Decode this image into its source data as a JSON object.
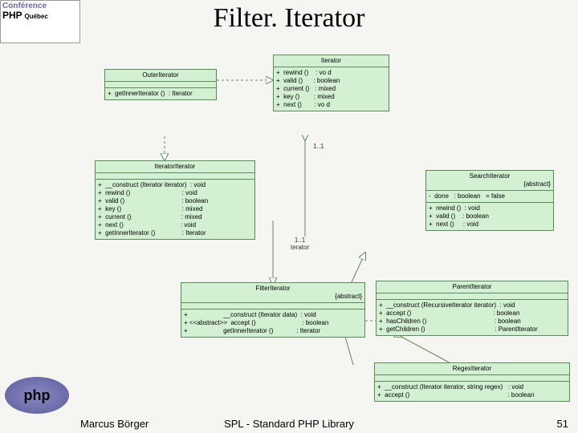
{
  "logo": {
    "line1": "Conférence",
    "line2": "PHP",
    "sub": "Québec"
  },
  "title": "Filter. Iterator",
  "roles": {
    "top": "1..1",
    "mid": "1..1\nterator"
  },
  "footer": {
    "author": "Marcus Börger",
    "center": "SPL - Standard PHP Library",
    "page": "51"
  },
  "php_logo": "php",
  "boxes": {
    "iterator": {
      "name": "Iterator",
      "ops": "+  rewind ()    : vo d\n+  valid ()      : boolean\n+  current ()   : mixed\n+  key ()        : mixed\n+  next ()       : vo d"
    },
    "outer": {
      "name": "OuterIterator",
      "ops": "+  getInnerIterator ()  : Iterator"
    },
    "iteratoriterator": {
      "name": "IteratorIterator",
      "ops": "+  __construct (Iterator iterator)  : void\n+  rewind ()                             : void\n+  valid ()                                : boolean\n+  key ()                                  : mixed\n+  current ()                            : mixed\n+  next ()                                : void\n+  getInnerIterator ()               : Iterator"
    },
    "search": {
      "name": "SearchIterator",
      "tag": "{abstract}",
      "attr": "-  done   : boolean   = false",
      "ops": "+  rewind ()  : void\n+  valid ()    : boolean\n+  next ()     : void"
    },
    "filter": {
      "name": "FilterIterator",
      "tag": "{abstract}",
      "ops": "+                    __construct (Iterator data)  : void\n+ <<abstract>>  accept ()                          : boolean\n+                    getInnerIterator ()             : Iterator"
    },
    "parent": {
      "name": "ParentIterator",
      "ops": "+  __construct (RecursiveIterator iterator)  : void\n+  accept ()                                              : boolean\n+  hasChildren ()                                      : boolean\n+  getChildren ()                                       : ParentIterator"
    },
    "regex": {
      "name": "RegexIterator",
      "ops": "+  __construct (Iterator iterator, string regex)   : void\n+  accept ()                                                       : boolean"
    }
  }
}
